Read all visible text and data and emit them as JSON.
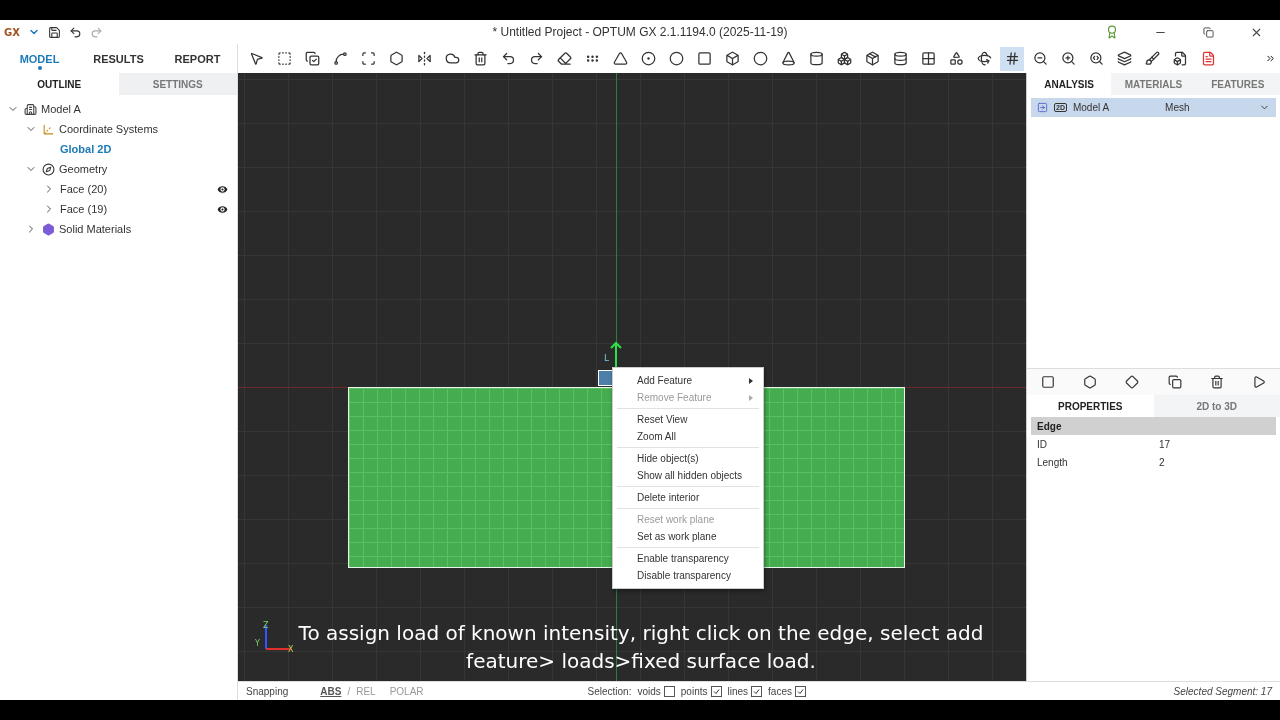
{
  "title_bar": {
    "logo": "GX",
    "title": "* Untitled Project - OPTUM GX 2.1.1194.0 (2025-11-19)"
  },
  "main_tabs": [
    {
      "label": "MODEL",
      "selected": true
    },
    {
      "label": "RESULTS",
      "selected": false
    },
    {
      "label": "REPORT",
      "selected": false
    }
  ],
  "outline_tabs": [
    {
      "label": "OUTLINE",
      "selected": true
    },
    {
      "label": "SETTINGS",
      "selected": false
    }
  ],
  "tree": [
    {
      "label": "Model A",
      "kind": "model",
      "expanded": true,
      "children": [
        {
          "label": "Coordinate Systems",
          "kind": "coords",
          "expanded": true,
          "children": [
            {
              "label": "Global 2D",
              "selected": true
            }
          ]
        },
        {
          "label": "Geometry",
          "kind": "geometry",
          "expanded": true,
          "children": [
            {
              "label": "Face (20)",
              "expanded": false,
              "visible": true
            },
            {
              "label": "Face (19)",
              "expanded": false,
              "visible": true
            }
          ]
        },
        {
          "label": "Solid Materials",
          "kind": "materials",
          "expanded": false
        }
      ]
    }
  ],
  "toolbar": {
    "grid_selected": true
  },
  "canvas": {
    "edge_label": "L",
    "axes": [
      "Z",
      "Y",
      "X"
    ],
    "context_menu": [
      [
        {
          "label": "Add Feature",
          "disabled": false,
          "submenu": true
        },
        {
          "label": "Remove Feature",
          "disabled": true,
          "submenu": true
        }
      ],
      [
        {
          "label": "Reset View",
          "disabled": false,
          "submenu": false
        },
        {
          "label": "Zoom All",
          "disabled": false,
          "submenu": false
        }
      ],
      [
        {
          "label": "Hide object(s)",
          "disabled": false,
          "submenu": false
        },
        {
          "label": "Show all hidden objects",
          "disabled": false,
          "submenu": false
        }
      ],
      [
        {
          "label": "Delete interior",
          "disabled": false,
          "submenu": false
        }
      ],
      [
        {
          "label": "Reset work plane",
          "disabled": true,
          "submenu": false
        },
        {
          "label": "Set as work plane",
          "disabled": false,
          "submenu": false
        }
      ],
      [
        {
          "label": "Enable transparency",
          "disabled": false,
          "submenu": false
        },
        {
          "label": "Disable transparency",
          "disabled": false,
          "submenu": false
        }
      ]
    ],
    "caption": "To assign load of known intensity, right click on the edge, select add feature> loads>fixed surface load."
  },
  "right_tabs": [
    {
      "label": "ANALYSIS",
      "selected": true
    },
    {
      "label": "MATERIALS",
      "selected": false
    },
    {
      "label": "FEATURES",
      "selected": false
    }
  ],
  "analysis": {
    "model": "Model A",
    "dimension": "2D",
    "mode": "Mesh"
  },
  "property_tabs": [
    {
      "label": "PROPERTIES",
      "selected": true
    },
    {
      "label": "2D to 3D",
      "selected": false
    }
  ],
  "properties": {
    "section": "Edge",
    "rows": [
      {
        "name": "ID",
        "value": "17"
      },
      {
        "name": "Length",
        "value": "2"
      }
    ]
  },
  "status_bar": {
    "snapping": "Snapping",
    "modes": [
      {
        "label": "ABS",
        "selected": true
      },
      {
        "label": "REL",
        "selected": false
      },
      {
        "label": "POLAR",
        "selected": false
      }
    ],
    "separator": "/",
    "selection_label": "Selection:",
    "filters": [
      {
        "label": "voids",
        "checked": false
      },
      {
        "label": "points",
        "checked": true
      },
      {
        "label": "lines",
        "checked": true
      },
      {
        "label": "faces",
        "checked": true
      }
    ],
    "info": "Selected Segment: 17"
  }
}
